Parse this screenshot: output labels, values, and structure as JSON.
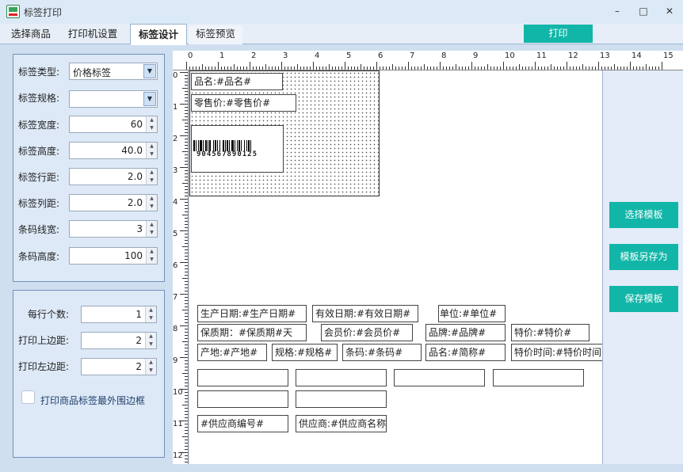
{
  "window": {
    "title": "标签打印",
    "minimize_glyph": "–",
    "maximize_glyph": "□",
    "close_glyph": "✕"
  },
  "tabs": [
    "选择商品",
    "打印机设置",
    "标签设计",
    "标签预览"
  ],
  "active_tab": "标签设计",
  "print_button": "打印",
  "settings": {
    "type_label": "标签类型:",
    "type_value": "价格标签",
    "spec_label": "标签规格:",
    "spec_value": "",
    "width_label": "标签宽度:",
    "width_value": "60",
    "height_label": "标签高度:",
    "height_value": "40.0",
    "row_gap_label": "标签行距:",
    "row_gap_value": "2.0",
    "col_gap_label": "标签列距:",
    "col_gap_value": "2.0",
    "bar_width_label": "条码线宽:",
    "bar_width_value": "3",
    "bar_height_label": "条码高度:",
    "bar_height_value": "100"
  },
  "print_settings": {
    "per_row_label": "每行个数:",
    "per_row_value": "1",
    "top_margin_label": "打印上边距:",
    "top_margin_value": "2",
    "left_margin_label": "打印左边距:",
    "left_margin_value": "2",
    "border_checkbox_label": "打印商品标签最外围边框",
    "border_checked": false
  },
  "ruler": {
    "h": [
      "0",
      "1",
      "2",
      "3",
      "4",
      "5",
      "6",
      "7",
      "8",
      "9",
      "10",
      "11",
      "12",
      "13",
      "14",
      "15"
    ],
    "v": [
      "0",
      "1",
      "2",
      "3",
      "4",
      "5",
      "6",
      "7",
      "8",
      "9",
      "10",
      "11",
      "12"
    ]
  },
  "label_elements": {
    "name": "品名:#品名#",
    "retail_price": "零售价:#零售价#",
    "barcode_number": "904567890125"
  },
  "fields": {
    "prod_date": "生产日期:#生产日期#",
    "expiry_date": "有效日期:#有效日期#",
    "unit": "单位:#单位#",
    "shelf_life": "保质期：#保质期#天",
    "member_price": "会员价:#会员价#",
    "brand": "品牌:#品牌#",
    "special_price": "特价:#特价#",
    "origin": "产地:#产地#",
    "spec": "规格:#规格#",
    "barcode": "条码:#条码#",
    "short_name": "品名:#简称#",
    "special_time": "特价时间:#特价时间#",
    "supplier_no": "#供应商编号#",
    "supplier_name": "供应商:#供应商名称#"
  },
  "side_buttons": [
    "选择模板",
    "模板另存为",
    "保存模板"
  ],
  "colors": {
    "accent": "#12b6a8",
    "panel": "#dde9f7"
  }
}
